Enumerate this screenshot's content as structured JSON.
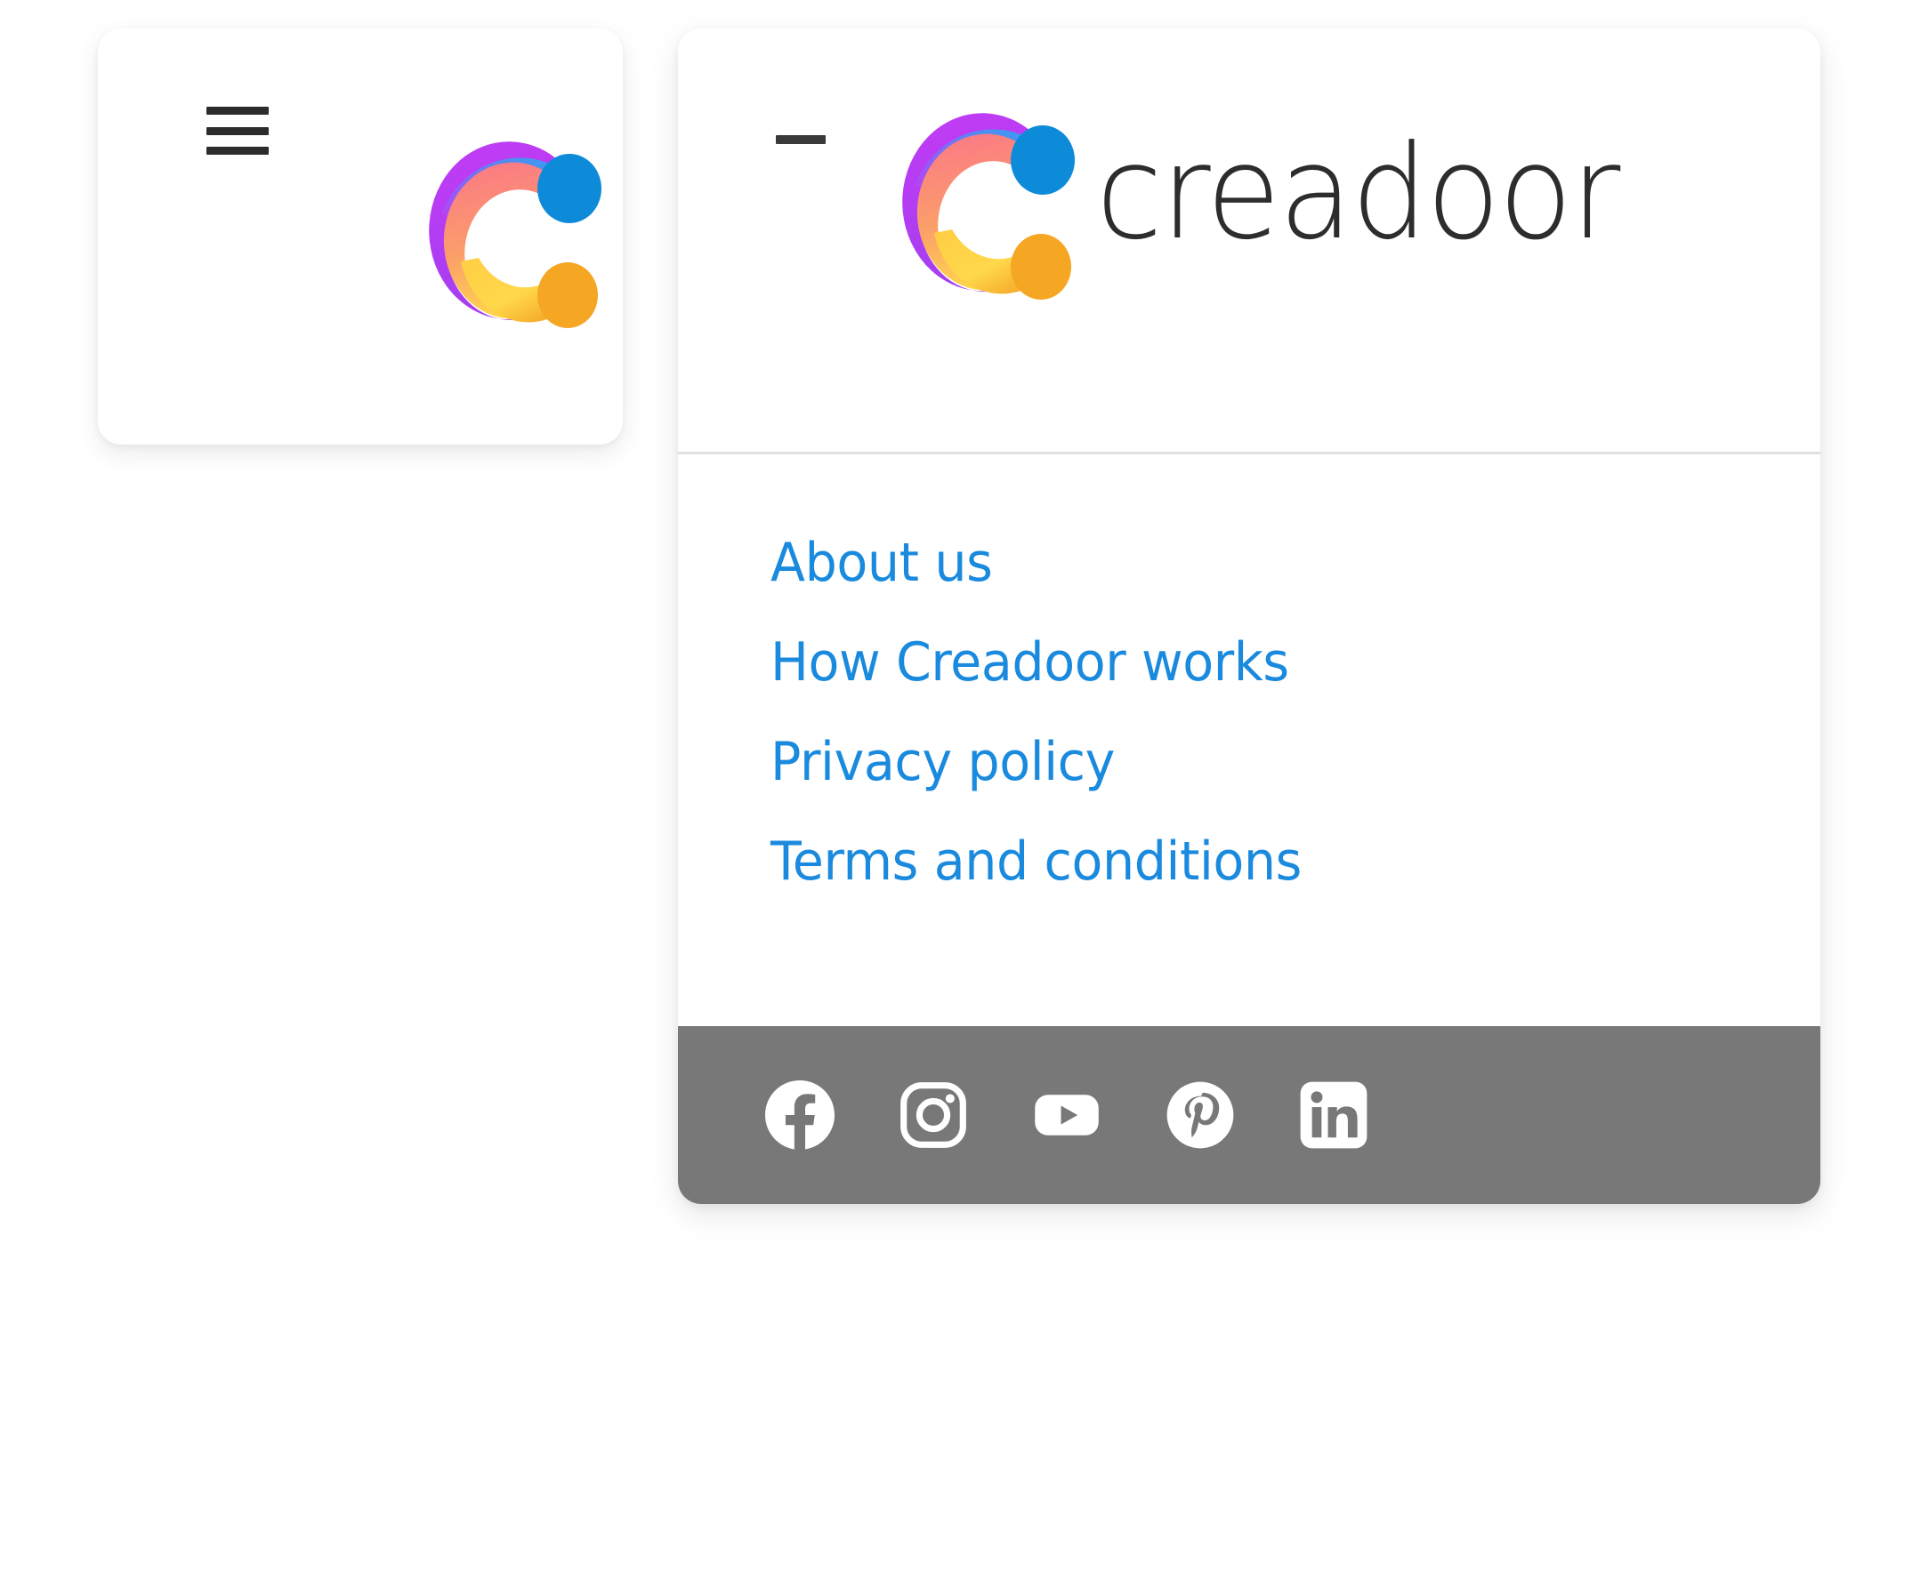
{
  "brand": {
    "name": "creadoor",
    "logo_icon": "creadoor-c-mark",
    "gradient": {
      "blue": "#0d8bd9",
      "light_blue": "#29a9f0",
      "purple": "#a43ef0",
      "magenta": "#c13cf5",
      "pink": "#fb7a85",
      "salmon": "#fb8f74",
      "orange": "#f5a623",
      "yellow": "#ffd84a"
    }
  },
  "logo_card": {
    "menu_toggle": {
      "icon": "hamburger-icon",
      "label": "Open menu",
      "state": "collapsed"
    }
  },
  "menu_panel": {
    "collapse_toggle": {
      "icon": "minus-icon",
      "label": "Close menu",
      "state": "expanded"
    },
    "links": [
      {
        "label": "About us",
        "name": "about-us"
      },
      {
        "label": "How Creadoor works",
        "name": "how-creadoor-works"
      },
      {
        "label": "Privacy policy",
        "name": "privacy-policy"
      },
      {
        "label": "Terms and conditions",
        "name": "terms-and-conditions"
      }
    ],
    "link_color": "#1a8ade",
    "social": {
      "background": "#787878",
      "items": [
        {
          "icon": "facebook-icon",
          "label": "Facebook"
        },
        {
          "icon": "instagram-icon",
          "label": "Instagram"
        },
        {
          "icon": "youtube-icon",
          "label": "YouTube"
        },
        {
          "icon": "pinterest-icon",
          "label": "Pinterest"
        },
        {
          "icon": "linkedin-icon",
          "label": "LinkedIn"
        }
      ]
    }
  }
}
